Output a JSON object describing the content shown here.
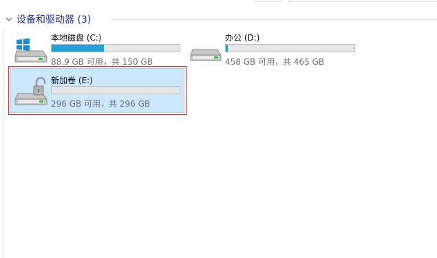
{
  "group": {
    "label": "设备和驱动器 (3)"
  },
  "drives": [
    {
      "name": "本地磁盘 (C:)",
      "info": "88.9 GB 可用，共 150 GB",
      "used_fraction": 0.407,
      "icon": "windows-system-drive-icon",
      "selected": false
    },
    {
      "name": "办公 (D:)",
      "info": "458 GB 可用，共 465 GB",
      "used_fraction": 0.015,
      "icon": "hard-drive-icon",
      "selected": false
    },
    {
      "name": "新加卷 (E:)",
      "info": "296 GB 可用，共 296 GB",
      "used_fraction": 0.0,
      "icon": "locked-drive-icon",
      "selected": true
    }
  ],
  "colors": {
    "accent_bar": "#26a0da",
    "selection_bg": "#cce8ff",
    "highlight_frame": "#d13438",
    "group_header": "#1e3287"
  }
}
